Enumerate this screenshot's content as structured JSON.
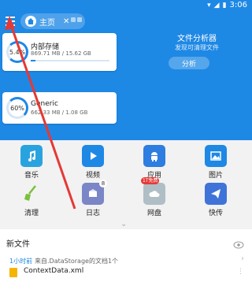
{
  "status": {
    "time": "3:06"
  },
  "toolbar": {
    "home_tab_label": "主页"
  },
  "storage": {
    "internal": {
      "percent_text": "5.4%",
      "title": "内部存储",
      "usage": "869.71 MB / 15.62 GB",
      "used_fraction": 0.054
    },
    "generic": {
      "percent_text": "60%",
      "title": "Generic",
      "usage": "662.33 MB / 1.08 GB",
      "used_fraction": 0.6
    }
  },
  "analyzer": {
    "title": "文件分析器",
    "subtitle": "发现可清理文件",
    "button": "分析"
  },
  "categories": [
    {
      "label": "音乐",
      "icon": "music-icon",
      "color": "#29a3e0"
    },
    {
      "label": "视频",
      "icon": "video-icon",
      "color": "#1e88e5"
    },
    {
      "label": "应用",
      "icon": "android-icon",
      "color": "#2e7de0"
    },
    {
      "label": "图片",
      "icon": "image-icon",
      "color": "#1e88e5"
    },
    {
      "label": "清理",
      "icon": "broom-icon",
      "color": "#7bbf3b"
    },
    {
      "label": "日志",
      "icon": "log-icon",
      "color": "#5c6bc0",
      "badge": "8"
    },
    {
      "label": "网盘",
      "icon": "cloud-icon",
      "color": "#e53935",
      "badge_text": "1T免费"
    },
    {
      "label": "快传",
      "icon": "send-icon",
      "color": "#1e88e5"
    }
  ],
  "recent": {
    "title": "新文件",
    "time": "1小时前",
    "from": "来自.DataStorage的文档1个",
    "file_name": "ContextData.xml"
  },
  "colors": {
    "primary": "#1e88e5",
    "annotation": "#e53935"
  }
}
